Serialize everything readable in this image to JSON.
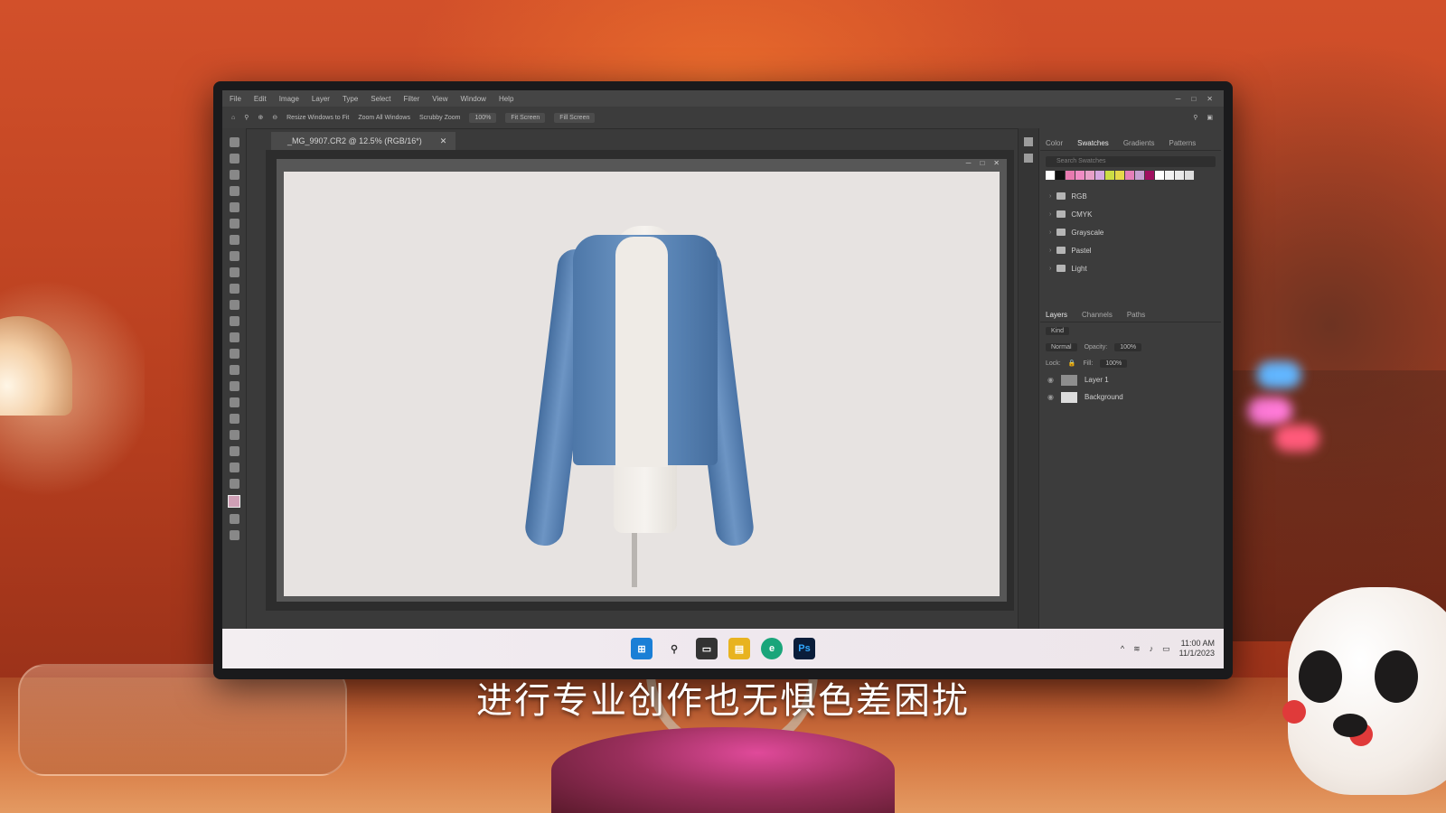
{
  "subtitle": "进行专业创作也无惧色差困扰",
  "photoshop": {
    "menu": [
      "File",
      "Edit",
      "Image",
      "Layer",
      "Type",
      "Select",
      "Filter",
      "View",
      "Window",
      "Help"
    ],
    "options": {
      "resize_windows": "Resize Windows to Fit",
      "zoom_all": "Zoom All Windows",
      "scrubby_zoom": "Scrubby Zoom",
      "zoom_percent": "100%",
      "fit_screen": "Fit Screen",
      "fill_screen": "Fill Screen"
    },
    "doc_tab": "_MG_9907.CR2 @ 12.5% (RGB/16*)",
    "swatches_panel": {
      "tabs": [
        "Color",
        "Swatches",
        "Gradients",
        "Patterns"
      ],
      "active_tab": "Swatches",
      "search_placeholder": "Search Swatches",
      "recent_colors": [
        "#ffffff",
        "#111111",
        "#e87ab0",
        "#f08cc4",
        "#e8a0c8",
        "#d6a7e0",
        "#ccdd44",
        "#e6d84a",
        "#e67fb8",
        "#c7a0d0",
        "#a01060",
        "#ffffff",
        "#f2f2f2",
        "#eaeaea",
        "#dddddd"
      ],
      "folders": [
        "RGB",
        "CMYK",
        "Grayscale",
        "Pastel",
        "Light"
      ]
    },
    "layers_panel": {
      "tabs": [
        "Layers",
        "Channels",
        "Paths"
      ],
      "active_tab": "Layers",
      "kind": "Kind",
      "blend_mode": "Normal",
      "opacity_label": "Opacity:",
      "opacity_value": "100%",
      "lock_label": "Lock:",
      "fill_label": "Fill:",
      "fill_value": "100%",
      "layers": [
        {
          "name": "Layer 1"
        },
        {
          "name": "Background"
        }
      ]
    }
  },
  "taskbar": {
    "time": "11:00 AM",
    "date": "11/1/2023"
  }
}
